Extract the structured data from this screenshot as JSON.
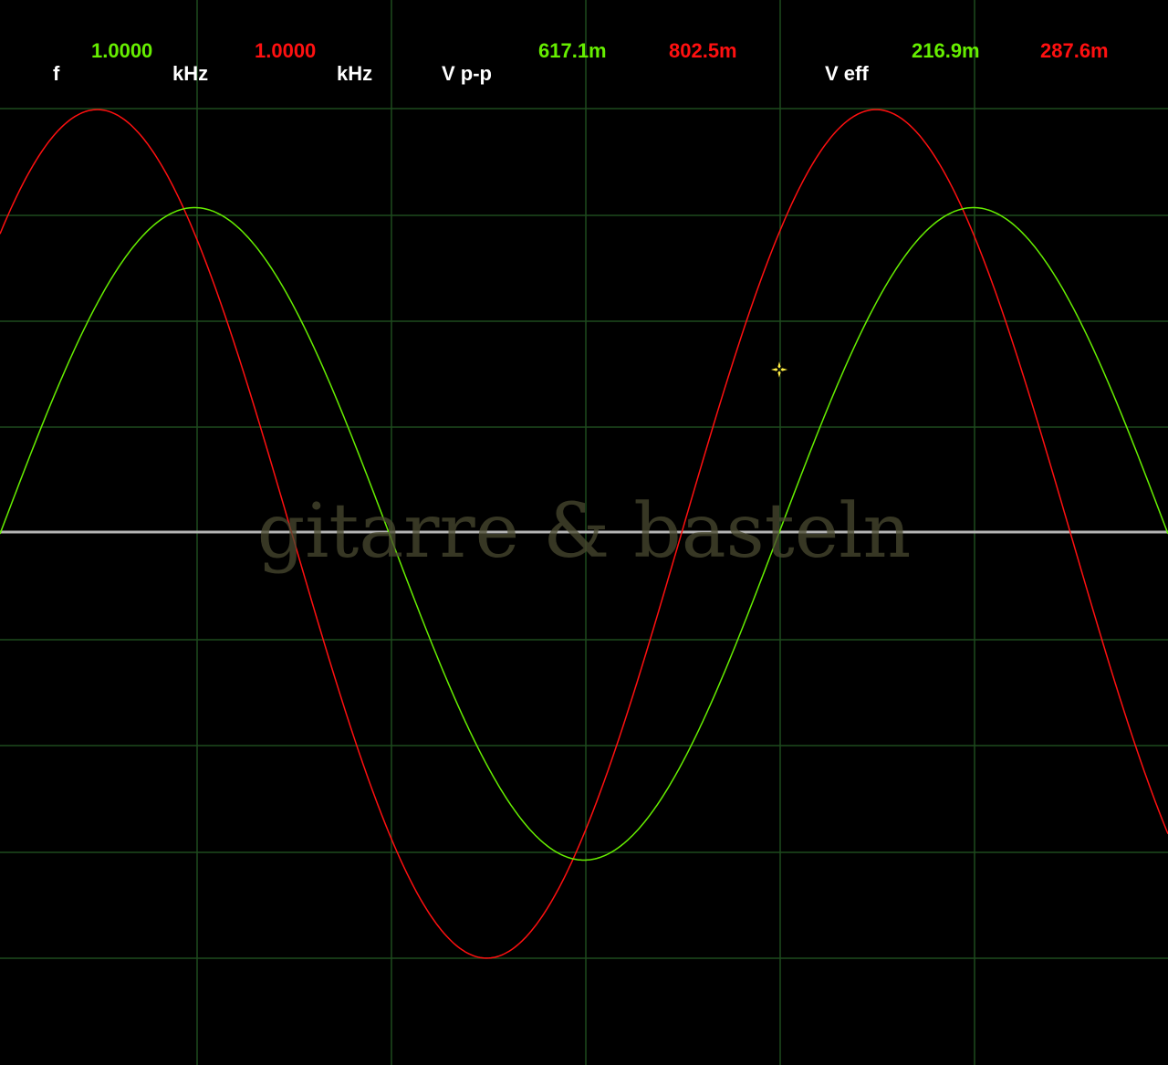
{
  "readouts": {
    "frequency": {
      "label": "f",
      "ch1_value": "1.0000",
      "ch1_unit": "kHz",
      "ch2_value": "1.0000",
      "ch2_unit": "kHz"
    },
    "vpp": {
      "label": "V p-p",
      "ch1_value": "617.1m",
      "ch2_value": "802.5m"
    },
    "veff": {
      "label": "V eff",
      "ch1_value": "216.9m",
      "ch2_value": "287.6m"
    }
  },
  "watermark": "gitarre & basteln",
  "colors": {
    "background": "#000000",
    "grid": "#1e4a1e",
    "center_line": "#b4b4b4",
    "ch1": "#66ee00",
    "ch2": "#ff1010",
    "cursor": "#ffee44"
  },
  "grid": {
    "vertical_divisions": 6,
    "horizontal_divisions": 10
  },
  "waveforms": [
    {
      "channel": 1,
      "frequency_khz": 1.0,
      "vpp_volts": 0.6171,
      "color": "#66ee00",
      "phase_deg": 0,
      "periods_on_screen": 1.5
    },
    {
      "channel": 2,
      "frequency_khz": 1.0,
      "vpp_volts": 0.8025,
      "color": "#ff1010",
      "phase_deg": 45,
      "periods_on_screen": 1.5
    }
  ]
}
